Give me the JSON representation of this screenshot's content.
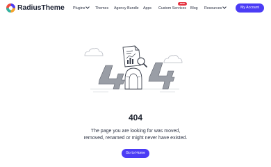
{
  "brand": {
    "name": "RadiusTheme",
    "accent": "#4b3cf5",
    "logo_colors": [
      "#f04b3c",
      "#4b3cf5",
      "#f4a52c",
      "#2fb5a3"
    ]
  },
  "nav": {
    "items": [
      {
        "label": "Plugins",
        "has_dropdown": true
      },
      {
        "label": "Themes",
        "has_dropdown": false
      },
      {
        "label": "Agency Bundle",
        "has_dropdown": false
      },
      {
        "label": "Apps",
        "has_dropdown": false
      },
      {
        "label": "Custom Services",
        "has_dropdown": false,
        "badge": "NEW"
      },
      {
        "label": "Blog",
        "has_dropdown": false
      },
      {
        "label": "Resources",
        "has_dropdown": true
      }
    ],
    "badge_color": "#e53340"
  },
  "header": {
    "account_label": "My Account"
  },
  "illustration": {
    "icon": "404-document-search-illustration"
  },
  "error": {
    "code": "404",
    "message_line1": "The page you are looking for was moved,",
    "message_line2": "removed, renamed or might never have existed."
  },
  "actions": {
    "home_label": "Go to Home"
  }
}
